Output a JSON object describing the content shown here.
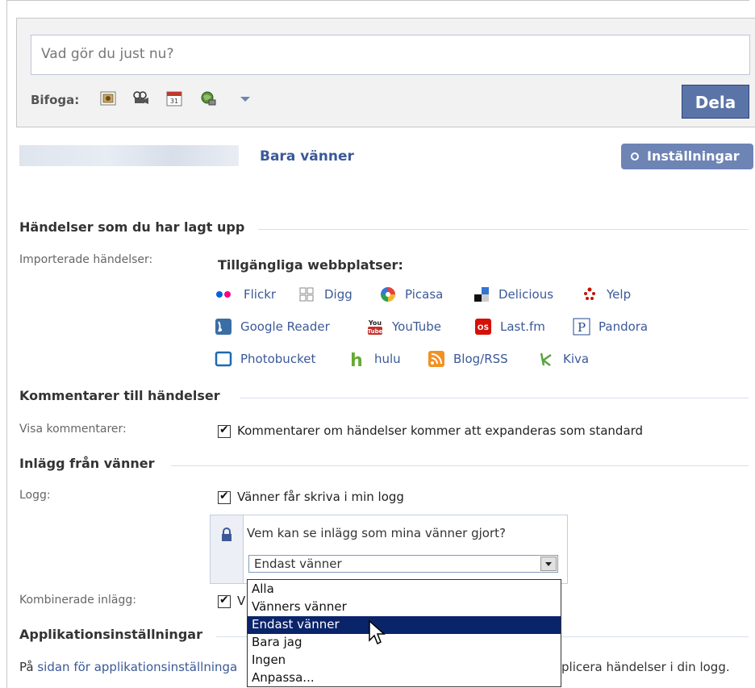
{
  "publisher": {
    "placeholder": "Vad gör du just nu?",
    "attach_label": "Bifoga:",
    "attach_icons": [
      "photo-icon",
      "video-icon",
      "event-icon",
      "link-icon"
    ],
    "share_label": "Dela"
  },
  "privacy_row": {
    "audience": "Bara vänner",
    "settings_label": "Inställningar"
  },
  "sections": {
    "events": {
      "title": "Händelser som du har lagt upp",
      "imported_label": "Importerade händelser:",
      "available_title": "Tillgängliga webbplatser:",
      "sites": [
        {
          "name": "Flickr",
          "icon": "flickr-icon"
        },
        {
          "name": "Digg",
          "icon": "digg-icon"
        },
        {
          "name": "Picasa",
          "icon": "picasa-icon"
        },
        {
          "name": "Delicious",
          "icon": "delicious-icon"
        },
        {
          "name": "Yelp",
          "icon": "yelp-icon"
        },
        {
          "name": "Google Reader",
          "icon": "google-reader-icon"
        },
        {
          "name": "YouTube",
          "icon": "youtube-icon"
        },
        {
          "name": "Last.fm",
          "icon": "lastfm-icon"
        },
        {
          "name": "Pandora",
          "icon": "pandora-icon"
        },
        {
          "name": "Photobucket",
          "icon": "photobucket-icon"
        },
        {
          "name": "hulu",
          "icon": "hulu-icon"
        },
        {
          "name": "Blog/RSS",
          "icon": "rss-icon"
        },
        {
          "name": "Kiva",
          "icon": "kiva-icon"
        }
      ]
    },
    "comments": {
      "title": "Kommentarer till händelser",
      "label": "Visa kommentarer:",
      "checkbox_text": "Kommentarer om händelser kommer att expanderas som standard"
    },
    "posts": {
      "title": "Inlägg från vänner",
      "logg_label": "Logg:",
      "logg_checkbox": "Vänner får skriva i min logg",
      "privacy_question": "Vem kan se inlägg som mina vänner gjort?",
      "select_value": "Endast vänner",
      "options": [
        "Alla",
        "Vänners vänner",
        "Endast vänner",
        "Bara jag",
        "Ingen",
        "Anpassa..."
      ],
      "combined_label": "Kombinerade inlägg:",
      "combined_checkbox_visible": "V"
    },
    "apps": {
      "title": "Applikationsinställningar",
      "text_before": "På ",
      "link": "sidan för applikationsinställninga",
      "text_after": "plicera händelser i din logg."
    }
  },
  "colors": {
    "brand": "#3b5998",
    "button": "#5b74a8",
    "selected_option": "#0a246a"
  }
}
